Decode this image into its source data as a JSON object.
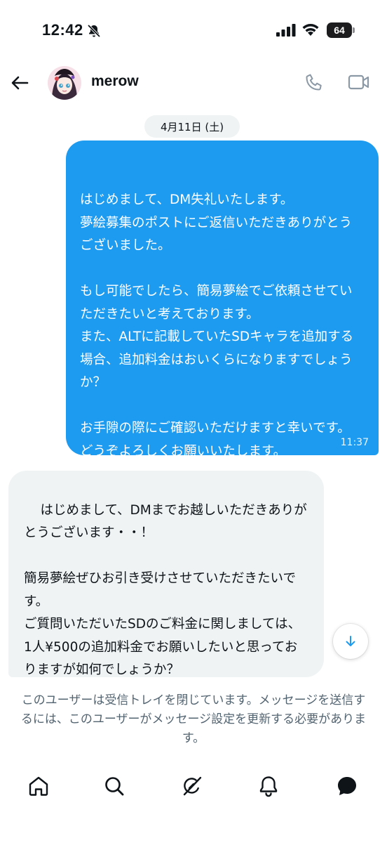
{
  "status_bar": {
    "time": "12:42",
    "battery": "64"
  },
  "header": {
    "contact_name": "merow"
  },
  "conversation": {
    "date_label": "4月11日 (土)",
    "messages": [
      {
        "direction": "sent",
        "text": "はじめまして、DM失礼いたします。\n夢絵募集のポストにご返信いただきありがとうございました。\n\nもし可能でしたら、簡易夢絵でご依頼させていただきたいと考えております。\nまた、ALTに記載していたSDキャラを追加する場合、追加料金はおいくらになりますでしょうか？\n\nお手隙の際にご確認いただけますと幸いです。\nどうぞよろしくお願いいたします。",
        "time": "11:37"
      },
      {
        "direction": "received",
        "text": "はじめまして、DMまでお越しいただきありがとうございます・・！\n\n簡易夢絵ぜひお引き受けさせていただきたいです。\nご質問いただいたSDのご料金に関しましては、1人¥500の追加料金でお願いしたいと思っておりますが如何でしょうか？"
      }
    ]
  },
  "notice": "このユーザーは受信トレイを閉じています。メッセージを送信するには、このユーザーがメッセージ設定を更新する必要があります。",
  "colors": {
    "accent": "#1d9bf0",
    "received_bubble": "#eff3f4",
    "secondary_text": "#536471",
    "icon_gray": "#8b98a5"
  },
  "nav": [
    "home-icon",
    "search-icon",
    "grok-icon",
    "notifications-icon",
    "messages-icon"
  ]
}
